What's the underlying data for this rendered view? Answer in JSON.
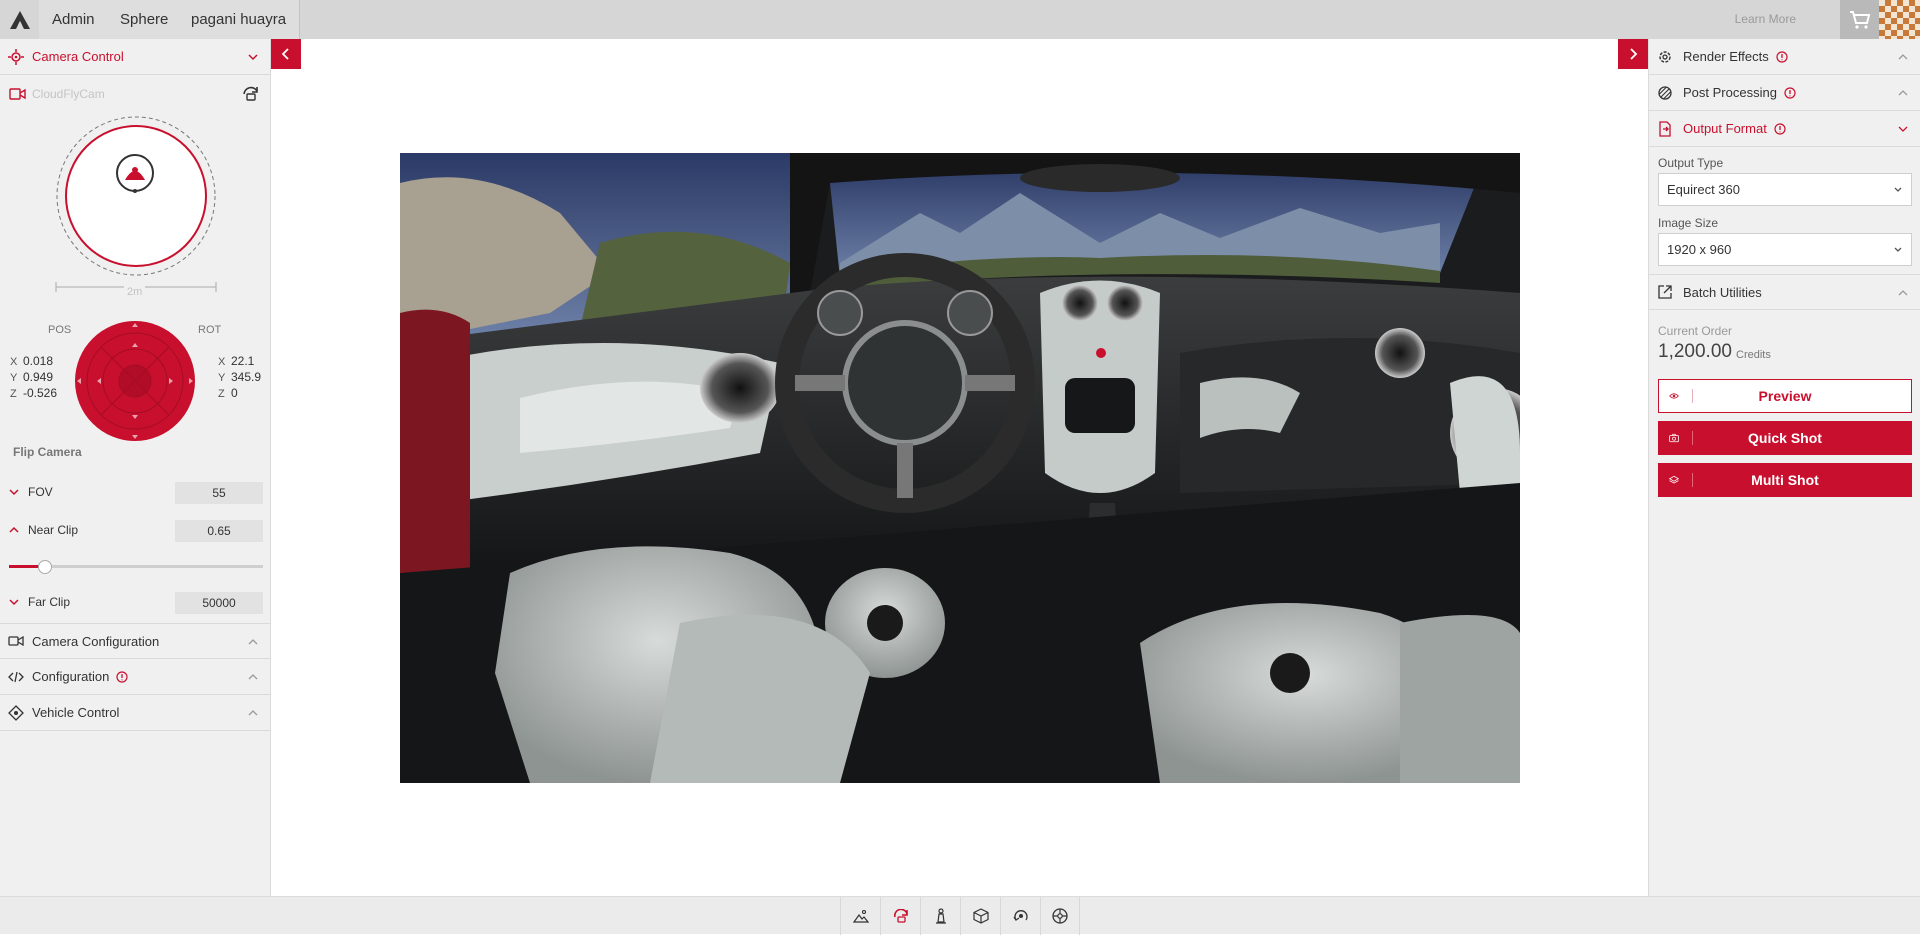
{
  "topbar": {
    "tabs": [
      {
        "label": "Admin"
      },
      {
        "label": "Sphere"
      },
      {
        "label": "pagani huayra"
      }
    ],
    "learn_more": "Learn More"
  },
  "left": {
    "camera_control": "Camera Control",
    "camera_name": "CloudFlyCam",
    "scale_label": "2m",
    "pos_label": "POS",
    "rot_label": "ROT",
    "pos": {
      "x": "0.018",
      "y": "0.949",
      "z": "-0.526"
    },
    "rot": {
      "x": "22.1",
      "y": "345.9",
      "z": "0"
    },
    "axis": {
      "x": "X",
      "y": "Y",
      "z": "Z"
    },
    "flip_camera": "Flip Camera",
    "fov": {
      "label": "FOV",
      "value": "55"
    },
    "near_clip": {
      "label": "Near Clip",
      "value": "0.65",
      "slider_fraction": 0.14
    },
    "far_clip": {
      "label": "Far Clip",
      "value": "50000"
    },
    "sections": [
      {
        "label": "Camera Configuration"
      },
      {
        "label": "Configuration"
      },
      {
        "label": "Vehicle Control"
      }
    ]
  },
  "right": {
    "render_effects": "Render Effects",
    "post_processing": "Post Processing",
    "output_format": "Output Format",
    "output_type_label": "Output Type",
    "output_type_value": "Equirect 360",
    "image_size_label": "Image Size",
    "image_size_value": "1920 x 960",
    "batch_utilities": "Batch Utilities",
    "current_order_label": "Current Order",
    "current_order_amount": "1,200.00",
    "credits": "Credits",
    "preview": "Preview",
    "quick_shot": "Quick Shot",
    "multi_shot": "Multi Shot"
  },
  "toolbar": {
    "tools": [
      "landscape-icon",
      "orbit-camera-icon",
      "chess-piece-icon",
      "cube-icon",
      "rotate-view-icon",
      "wheel-icon"
    ],
    "active_index": 1
  },
  "colors": {
    "accent": "#c8102e",
    "panel": "#f0f0f0",
    "topbar": "#d6d6d6"
  }
}
